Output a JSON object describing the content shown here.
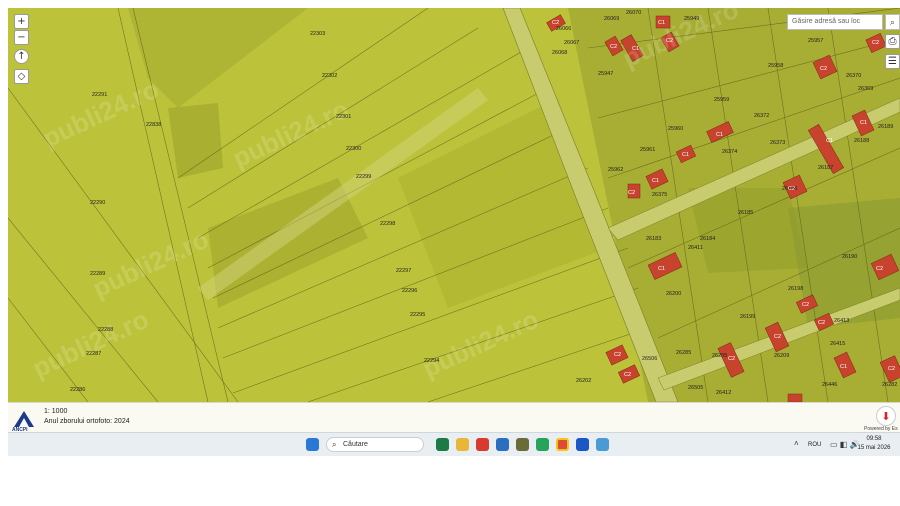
{
  "map": {
    "parcel_labels": [
      "22303",
      "22302",
      "22301",
      "22300",
      "22299",
      "22298",
      "22297",
      "22296",
      "22295",
      "22294",
      "22293",
      "22291",
      "22290",
      "22289",
      "22288",
      "22287",
      "22286",
      "22838",
      "26066",
      "26067",
      "26068",
      "26069",
      "26070",
      "25949",
      "25947",
      "25958",
      "25959",
      "25960",
      "25961",
      "25962",
      "25957",
      "26370",
      "26369",
      "26372",
      "26373",
      "26374",
      "26375",
      "26183",
      "26184",
      "26185",
      "26186",
      "26187",
      "26188",
      "26189",
      "26190",
      "26198",
      "26199",
      "26200",
      "26202",
      "26205",
      "26209",
      "26412",
      "26413",
      "26415",
      "26411",
      "26446",
      "26282",
      "26284",
      "26285",
      "26505",
      "26506",
      "26425",
      "26168"
    ],
    "building_labels": [
      "C1",
      "C2"
    ],
    "watermark": "publi24.ro"
  },
  "controls": {
    "zoom_in": "+",
    "zoom_out": "−",
    "search_placeholder": "Găsire adresă sau loc"
  },
  "info": {
    "scale": "1: 1000",
    "year": "Anul zborului ortofoto: 2024",
    "logo_text": "ANCPI",
    "powered_by": "Powered by Es"
  },
  "taskbar": {
    "search_label": "Căutare",
    "language": "ROU",
    "time": "09:58",
    "date": "15 mai 2026"
  },
  "colors": {
    "field": "#bcc33a",
    "field_dark": "#a9ae30",
    "roof": "#c8432e",
    "road": "#c9cc6e"
  }
}
